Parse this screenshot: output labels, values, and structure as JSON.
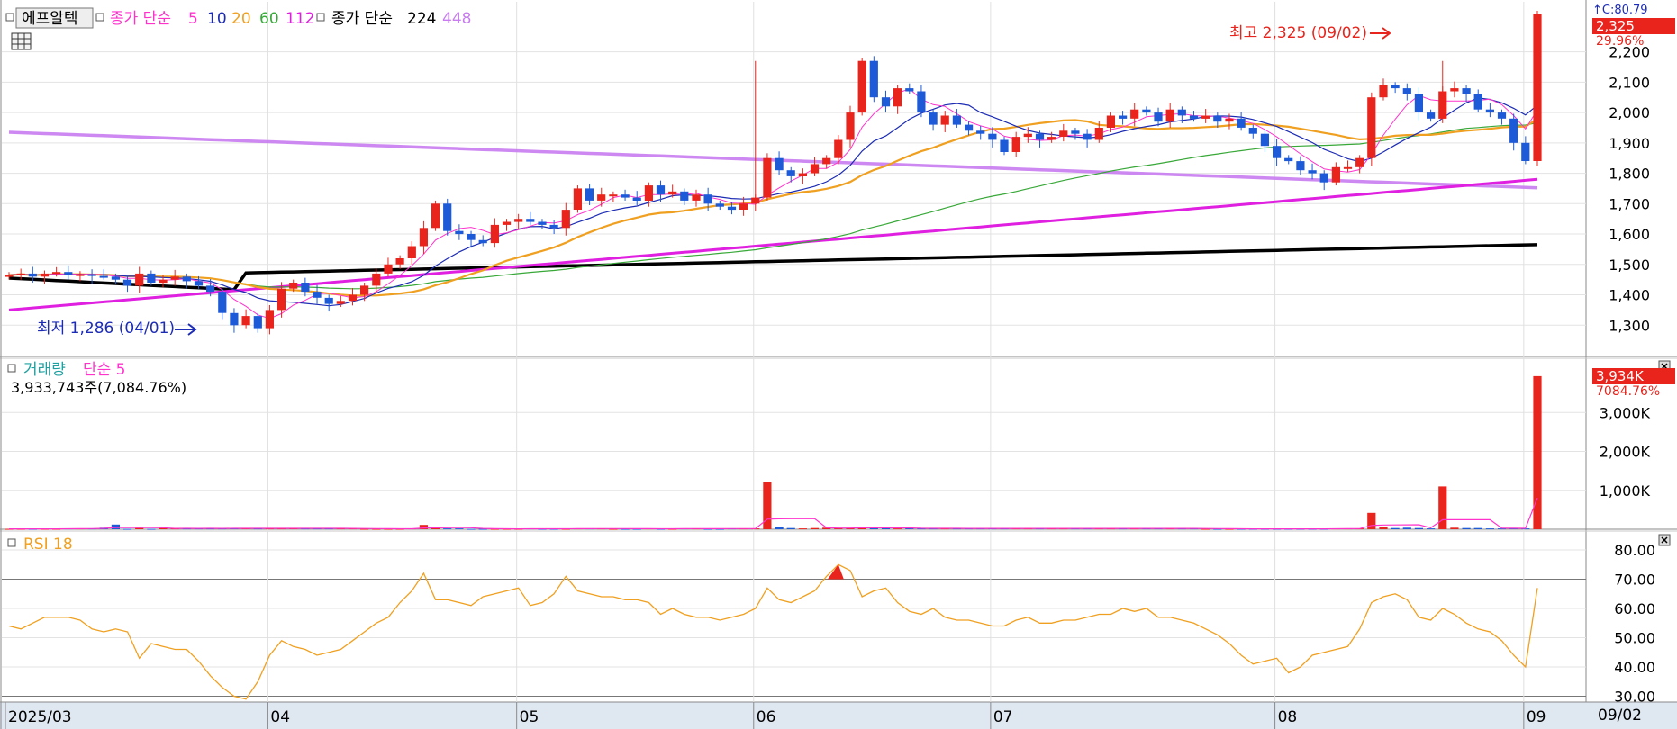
{
  "legend": {
    "name": "에프알텍",
    "ma_title": "종가 단순",
    "ma_periods": [
      "5",
      "10",
      "20",
      "60",
      "112"
    ],
    "ma2_title": "종가 단순",
    "ma2_periods": [
      "224",
      "448"
    ],
    "colors": {
      "ma5": "#ff33cc",
      "ma10": "#1c2cb4",
      "ma20": "#f0a020",
      "ma60": "#38a838",
      "ma112": "#e020e0",
      "ma224": "#000000",
      "ma448": "#c87cf0"
    }
  },
  "price_panel": {
    "high_note": "최고 2,325 (09/02)",
    "low_note": "최저 1,286 (04/01)",
    "last_price_badge": "2,325",
    "last_change": "29.96%",
    "top_clip_text": "↑C:80.79"
  },
  "volume_panel": {
    "title": "거래량",
    "ma_label": "단순 5",
    "summary": "3,933,743주(7,084.76%)",
    "last_badge": "3,934K",
    "last_ratio": "7084.76%"
  },
  "rsi_panel": {
    "title": "RSI 18"
  },
  "x_axis": {
    "labels": [
      "2025/03",
      "04",
      "05",
      "06",
      "07",
      "08",
      "09"
    ],
    "last_date": "09/02"
  },
  "chart_data": [
    {
      "type": "candlestick",
      "title": "에프알텍",
      "y_ticks": [
        "1,300",
        "1,400",
        "1,500",
        "1,600",
        "1,700",
        "1,800",
        "1,900",
        "2,000",
        "2,100",
        "2,200"
      ],
      "ylim": [
        1200,
        2350
      ],
      "months": [
        {
          "label": "2025/03",
          "start_index": 0
        },
        {
          "label": "04",
          "start_index": 22
        },
        {
          "label": "05",
          "start_index": 43
        },
        {
          "label": "06",
          "start_index": 63
        },
        {
          "label": "07",
          "start_index": 83
        },
        {
          "label": "08",
          "start_index": 107
        },
        {
          "label": "09",
          "start_index": 128
        }
      ],
      "closes": [
        1465,
        1470,
        1460,
        1470,
        1475,
        1465,
        1468,
        1462,
        1460,
        1450,
        1430,
        1470,
        1440,
        1450,
        1460,
        1445,
        1430,
        1410,
        1340,
        1300,
        1330,
        1290,
        1350,
        1420,
        1440,
        1410,
        1390,
        1370,
        1380,
        1400,
        1430,
        1470,
        1500,
        1520,
        1560,
        1620,
        1700,
        1610,
        1600,
        1580,
        1570,
        1630,
        1640,
        1650,
        1640,
        1630,
        1620,
        1680,
        1750,
        1710,
        1730,
        1730,
        1720,
        1710,
        1760,
        1730,
        1740,
        1710,
        1730,
        1700,
        1690,
        1680,
        1700,
        1720,
        1850,
        1810,
        1790,
        1800,
        1830,
        1850,
        1910,
        2000,
        2170,
        2050,
        2020,
        2080,
        2070,
        2000,
        1960,
        1990,
        1960,
        1940,
        1930,
        1910,
        1870,
        1920,
        1930,
        1910,
        1920,
        1940,
        1930,
        1910,
        1950,
        1990,
        1980,
        2010,
        2000,
        1970,
        2010,
        1990,
        1980,
        1990,
        1970,
        1980,
        1950,
        1930,
        1890,
        1850,
        1840,
        1810,
        1800,
        1770,
        1820,
        1820,
        1850,
        2050,
        2090,
        2080,
        2060,
        2000,
        1980,
        2070,
        2080,
        2060,
        2010,
        2000,
        1980,
        1900,
        1840,
        2325
      ],
      "volumes_K": [
        10,
        10,
        10,
        10,
        10,
        20,
        20,
        20,
        40,
        120,
        10,
        30,
        10,
        30,
        20,
        20,
        20,
        20,
        20,
        30,
        30,
        20,
        20,
        20,
        30,
        20,
        20,
        20,
        20,
        20,
        10,
        10,
        10,
        10,
        20,
        110,
        40,
        20,
        20,
        10,
        10,
        10,
        10,
        10,
        20,
        10,
        10,
        10,
        20,
        20,
        20,
        10,
        10,
        10,
        20,
        10,
        10,
        20,
        20,
        10,
        10,
        20,
        20,
        20,
        1220,
        60,
        30,
        20,
        30,
        40,
        30,
        30,
        60,
        30,
        30,
        20,
        30,
        20,
        20,
        20,
        20,
        20,
        20,
        20,
        20,
        20,
        20,
        20,
        20,
        20,
        20,
        20,
        20,
        20,
        20,
        20,
        20,
        20,
        20,
        20,
        20,
        10,
        10,
        10,
        10,
        10,
        10,
        10,
        10,
        10,
        10,
        10,
        20,
        20,
        20,
        420,
        60,
        30,
        40,
        30,
        20,
        1100,
        40,
        30,
        30,
        20,
        20,
        30,
        20,
        3934
      ]
    },
    {
      "type": "line",
      "title": "RSI 18",
      "y_ticks": [
        "30.00",
        "40.00",
        "50.00",
        "60.00",
        "70.00",
        "80.00"
      ],
      "ylim": [
        28,
        84
      ],
      "values": [
        54,
        53,
        55,
        57,
        57,
        57,
        56,
        53,
        52,
        53,
        52,
        43,
        48,
        47,
        46,
        46,
        42,
        37,
        33,
        30,
        29,
        35,
        44,
        49,
        47,
        46,
        44,
        45,
        46,
        49,
        52,
        55,
        57,
        62,
        66,
        72,
        63,
        63,
        62,
        61,
        64,
        65,
        66,
        67,
        61,
        62,
        65,
        71,
        66,
        65,
        64,
        64,
        63,
        63,
        62,
        58,
        60,
        58,
        57,
        57,
        56,
        57,
        58,
        60,
        67,
        63,
        62,
        64,
        66,
        71,
        75,
        73,
        64,
        66,
        67,
        62,
        59,
        58,
        60,
        57,
        56,
        56,
        55,
        54,
        54,
        56,
        57,
        55,
        55,
        56,
        56,
        57,
        58,
        58,
        60,
        59,
        60,
        57,
        57,
        56,
        55,
        53,
        51,
        48,
        44,
        41,
        42,
        43,
        38,
        40,
        44,
        45,
        46,
        47,
        53,
        62,
        64,
        65,
        63,
        57,
        56,
        60,
        58,
        55,
        53,
        52,
        49,
        44,
        40,
        67
      ]
    }
  ]
}
